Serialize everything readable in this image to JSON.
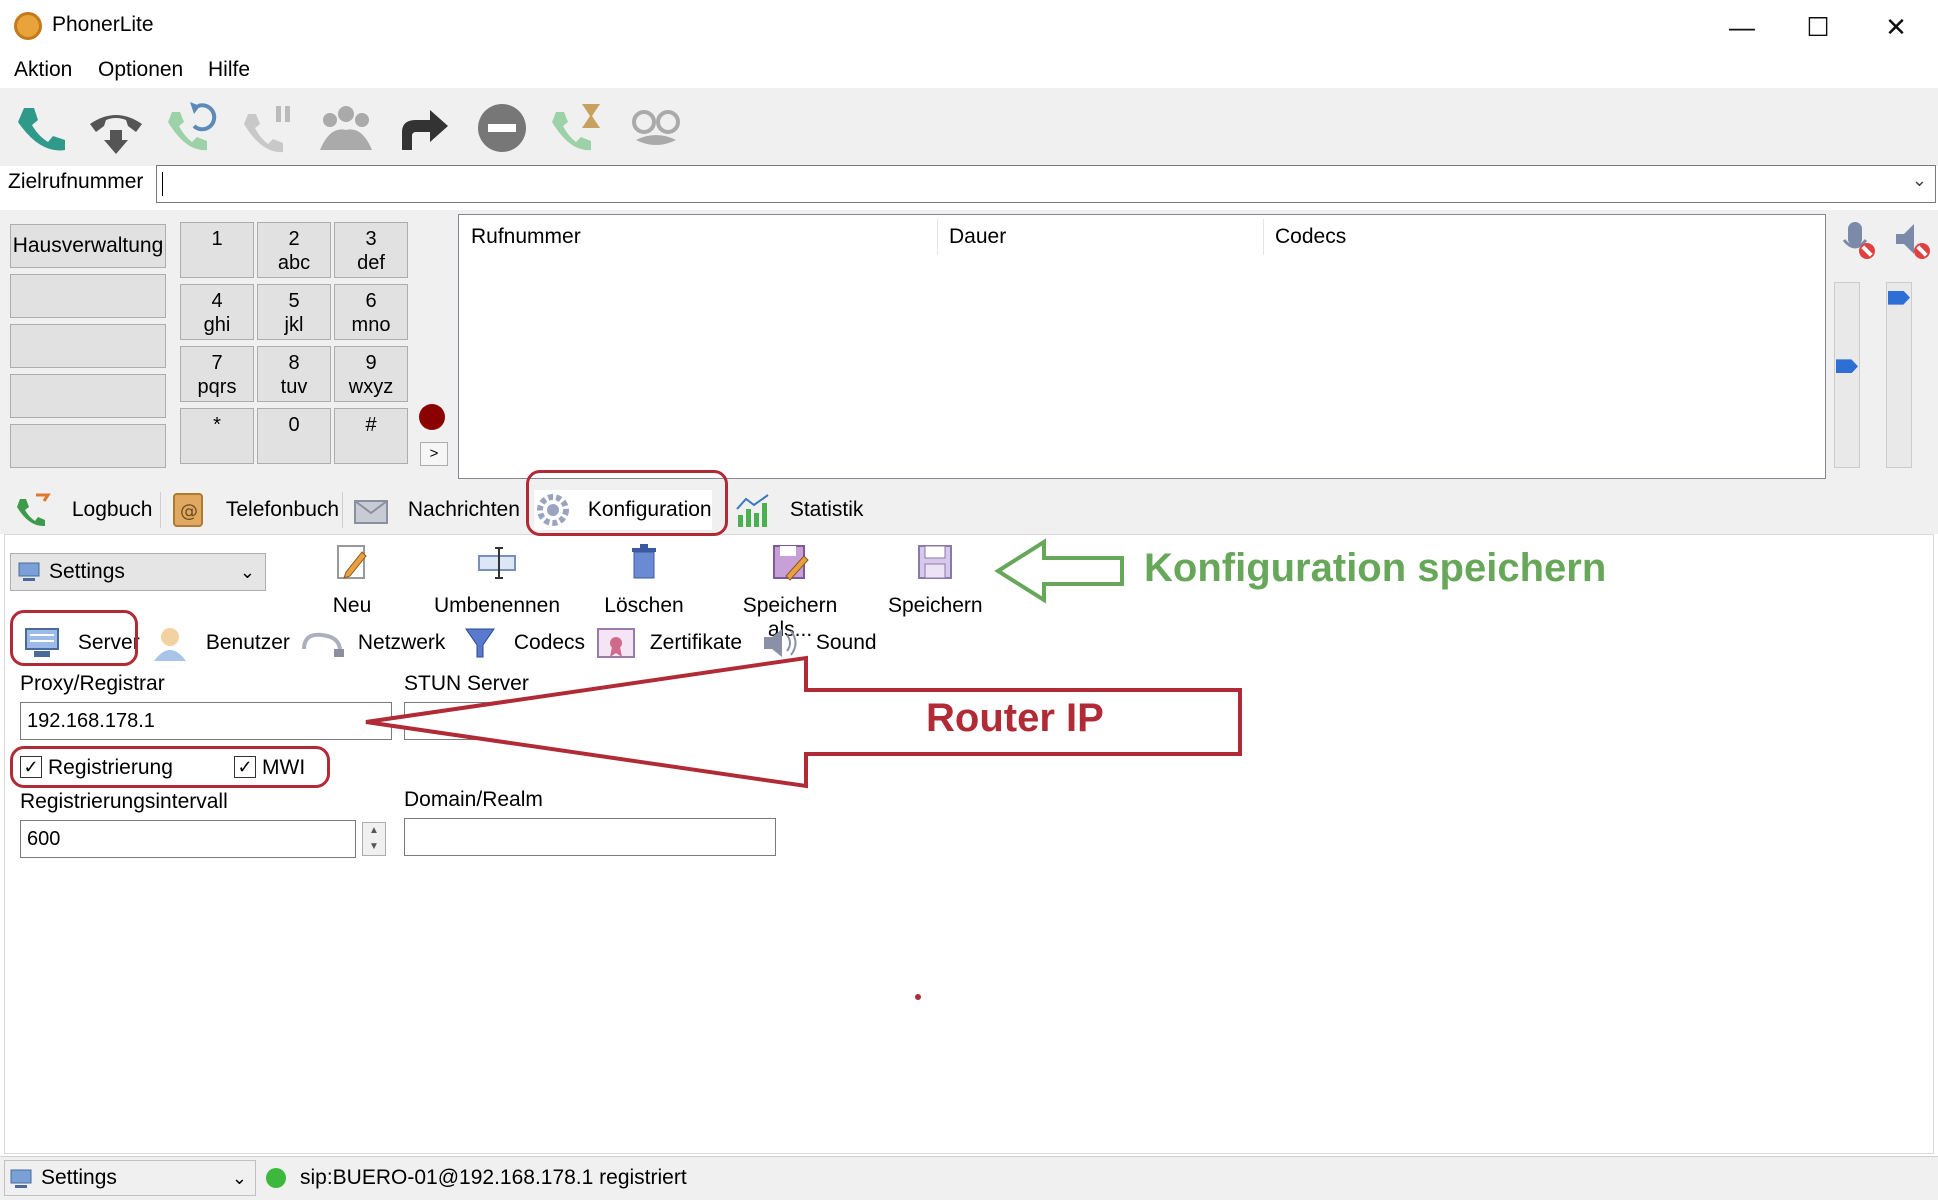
{
  "window": {
    "title": "PhonerLite",
    "minimize": "—",
    "maximize": "☐",
    "close": "✕"
  },
  "menu": [
    "Aktion",
    "Optionen",
    "Hilfe"
  ],
  "toolbar_icons": [
    "call-icon",
    "hangup-icon",
    "redial-icon",
    "hold-icon",
    "conference-icon",
    "forward-icon",
    "do-not-disturb-icon",
    "callback-icon",
    "anonymous-icon"
  ],
  "destination": {
    "label": "Zielrufnummer",
    "value": ""
  },
  "speed_dial": [
    "Hausverwaltung",
    "",
    "",
    "",
    ""
  ],
  "keypad": [
    {
      "d": "1",
      "l": ""
    },
    {
      "d": "2",
      "l": "abc"
    },
    {
      "d": "3",
      "l": "def"
    },
    {
      "d": "4",
      "l": "ghi"
    },
    {
      "d": "5",
      "l": "jkl"
    },
    {
      "d": "6",
      "l": "mno"
    },
    {
      "d": "7",
      "l": "pqrs"
    },
    {
      "d": "8",
      "l": "tuv"
    },
    {
      "d": "9",
      "l": "wxyz"
    },
    {
      "d": "*",
      "l": ""
    },
    {
      "d": "0",
      "l": ""
    },
    {
      "d": "#",
      "l": ""
    }
  ],
  "more_button": ">",
  "call_list": {
    "columns": [
      "Rufnummer",
      "Dauer",
      "Codecs"
    ]
  },
  "volume": {
    "microphone_level": 0.55,
    "speaker_level": 0.95
  },
  "main_tabs": [
    "Logbuch",
    "Telefonbuch",
    "Nachrichten",
    "Konfiguration",
    "Statistik"
  ],
  "active_tab": "Konfiguration",
  "profile": {
    "selected": "Settings"
  },
  "actions": [
    "Neu",
    "Umbenennen",
    "Löschen",
    "Speichern als...",
    "Speichern"
  ],
  "sub_tabs": [
    "Server",
    "Benutzer",
    "Netzwerk",
    "Codecs",
    "Zertifikate",
    "Sound"
  ],
  "active_sub_tab": "Server",
  "server": {
    "proxy_label": "Proxy/Registrar",
    "proxy_value": "192.168.178.1",
    "stun_label": "STUN Server",
    "stun_value": "",
    "registrierung_label": "Registrierung",
    "mwi_label": "MWI",
    "interval_label": "Registrierungsintervall",
    "interval_value": "600",
    "domain_label": "Domain/Realm",
    "domain_value": ""
  },
  "annotations": {
    "save": "Konfiguration speichern",
    "router": "Router IP"
  },
  "status": {
    "profile": "Settings",
    "text": "sip:BUERO-01@192.168.178.1 registriert",
    "state_color": "#3cb83c"
  },
  "colors": {
    "annotation_red": "#b02b36",
    "annotation_green": "#67a75a",
    "accent_blue": "#2e6fd6"
  }
}
